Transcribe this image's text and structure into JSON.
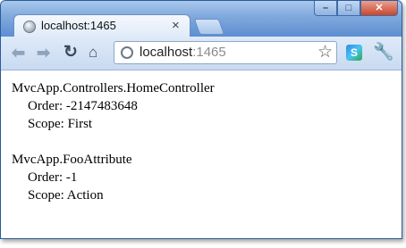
{
  "browser": {
    "tab": {
      "title": "localhost:1465",
      "close_glyph": "×"
    },
    "window_buttons": {
      "minimize": "–",
      "maximize": "□",
      "close": "✕"
    },
    "toolbar": {
      "back_glyph": "⬅",
      "forward_glyph": "➡",
      "reload_glyph": "↻",
      "home_glyph": "⌂",
      "star_glyph": "☆",
      "wrench_glyph": "🔧"
    },
    "address": {
      "host": "localhost",
      "port": ":1465"
    }
  },
  "page": {
    "entries": [
      {
        "name": "MvcApp.Controllers.HomeController",
        "order": "Order: -2147483648",
        "scope": "Scope: First"
      },
      {
        "name": "MvcApp.FooAttribute",
        "order": "Order: -1",
        "scope": "Scope: Action"
      }
    ]
  }
}
